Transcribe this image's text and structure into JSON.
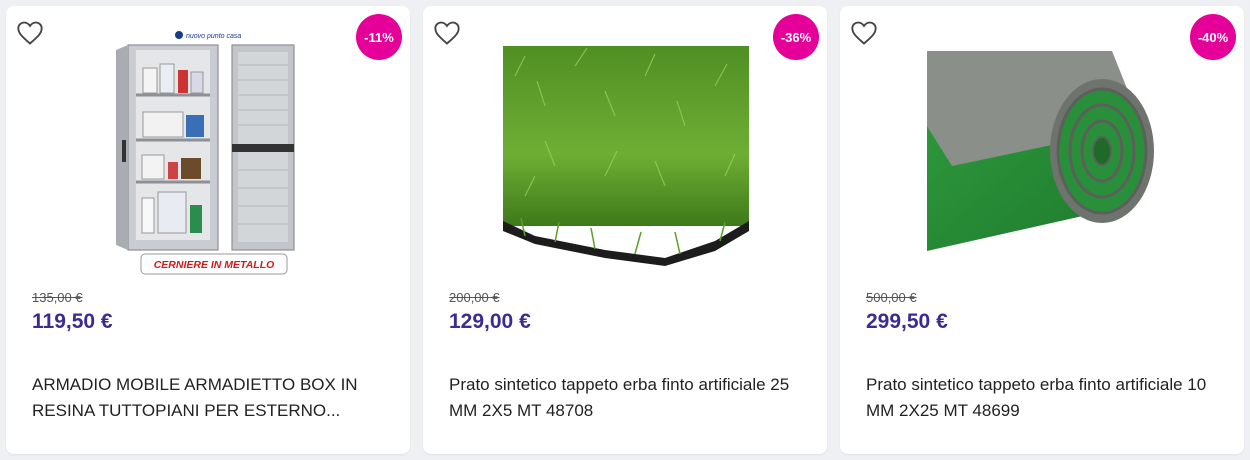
{
  "products": [
    {
      "discount": "-11%",
      "old_price": "135,00 €",
      "price": "119,50 €",
      "title": "ARMADIO MOBILE ARMADIETTO BOX IN RESINA TUTTOPIANI PER ESTERNO...",
      "image_caption": "CERNIERE IN METALLO",
      "image_logo": "nuovo punto casa"
    },
    {
      "discount": "-36%",
      "old_price": "200,00 €",
      "price": "129,00 €",
      "title": "Prato sintetico tappeto erba finto artificiale 25 MM 2X5 MT 48708"
    },
    {
      "discount": "-40%",
      "old_price": "500,00 €",
      "price": "299,50 €",
      "title": "Prato sintetico tappeto erba finto artificiale 10 MM 2X25 MT 48699"
    }
  ],
  "colors": {
    "badge": "#e5009a",
    "price": "#3a2d8f",
    "background": "#eef0f3"
  },
  "icons": {
    "wishlist": "heart-outline-icon"
  }
}
